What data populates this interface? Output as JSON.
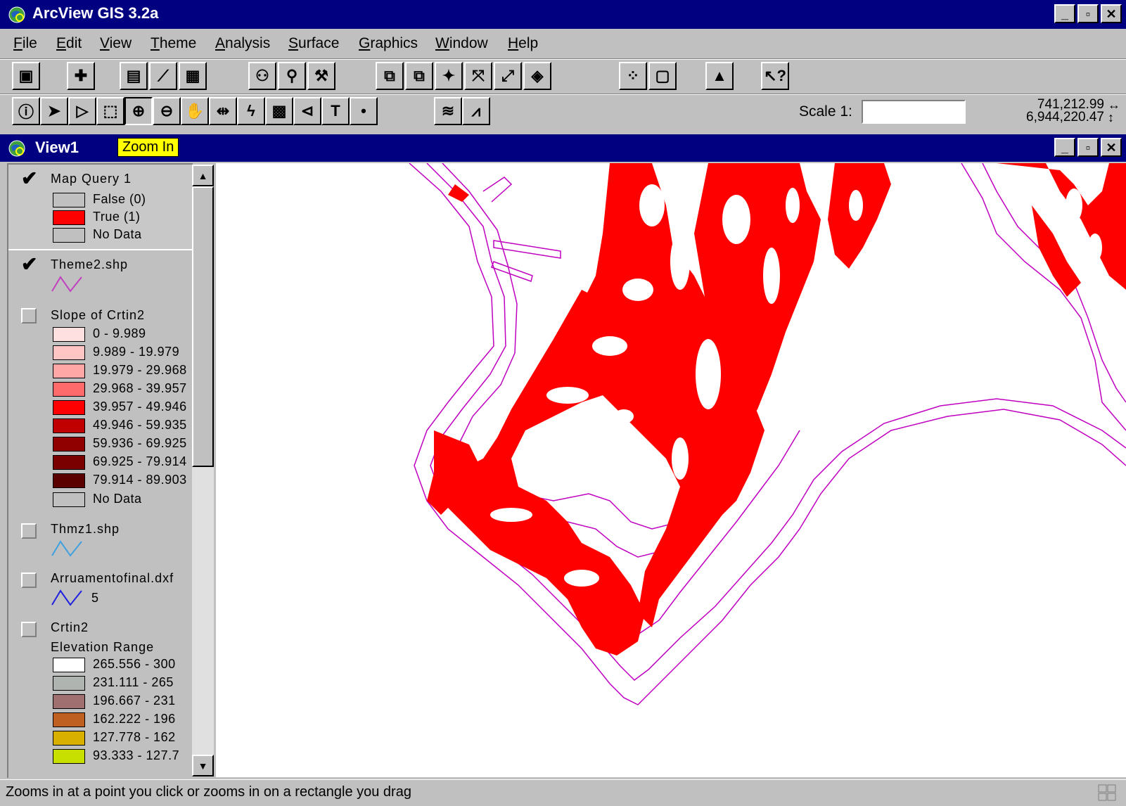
{
  "app": {
    "title": "ArcView GIS 3.2a",
    "menu": [
      "File",
      "Edit",
      "View",
      "Theme",
      "Analysis",
      "Surface",
      "Graphics",
      "Window",
      "Help"
    ],
    "menu_underline": [
      "F",
      "E",
      "V",
      "T",
      "A",
      "S",
      "G",
      "W",
      "H"
    ]
  },
  "toolbar": {
    "scale_label": "Scale 1:",
    "scale_value": "",
    "coord_x": "741,212.99",
    "coord_y": "6,944,220.47"
  },
  "view": {
    "title": "View1",
    "tooltip": "Zoom In"
  },
  "toc": {
    "themes": [
      {
        "name": "Map Query 1",
        "checked": true,
        "legend": [
          {
            "label": "False (0)",
            "color": "#c0c0c0"
          },
          {
            "label": "True (1)",
            "color": "#ff0000"
          },
          {
            "label": "No Data",
            "color": "#c0c0c0"
          }
        ]
      },
      {
        "name": "Theme2.shp",
        "checked": true
      },
      {
        "name": "Slope of Crtin2",
        "checked": false,
        "legend": [
          {
            "label": "0 - 9.989",
            "color": "#ffe0e0"
          },
          {
            "label": "9.989 - 19.979",
            "color": "#ffc4c4"
          },
          {
            "label": "19.979 - 29.968",
            "color": "#ffa6a6"
          },
          {
            "label": "29.968 - 39.957",
            "color": "#ff6a6a"
          },
          {
            "label": "39.957 - 49.946",
            "color": "#ff0000"
          },
          {
            "label": "49.946 - 59.935",
            "color": "#c00000"
          },
          {
            "label": "59.936 - 69.925",
            "color": "#900000"
          },
          {
            "label": "69.925 - 79.914",
            "color": "#7a0000"
          },
          {
            "label": "79.914 - 89.903",
            "color": "#5a0000"
          },
          {
            "label": "No Data",
            "color": "#c0c0c0"
          }
        ]
      },
      {
        "name": "Thmz1.shp",
        "checked": false
      },
      {
        "name": "Arruamentofinal.dxf",
        "checked": false,
        "line_label": "5"
      },
      {
        "name": "Crtin2",
        "checked": false,
        "sub": "Elevation Range",
        "legend": [
          {
            "label": "265.556 - 300",
            "color": "#ffffff"
          },
          {
            "label": "231.111 - 265",
            "color": "#b0b4b0"
          },
          {
            "label": "196.667 - 231",
            "color": "#a07070"
          },
          {
            "label": "162.222 - 196",
            "color": "#c06020"
          },
          {
            "label": "127.778 - 162",
            "color": "#d8b000"
          },
          {
            "label": "93.333 - 127.7",
            "color": "#c8e000"
          }
        ]
      }
    ]
  },
  "status": {
    "message": "Zooms in at a point you click or zooms in on a rectangle you drag"
  },
  "colors": {
    "titlebar": "#000080",
    "query_true": "#ff0000",
    "contour": "#c000c0"
  }
}
